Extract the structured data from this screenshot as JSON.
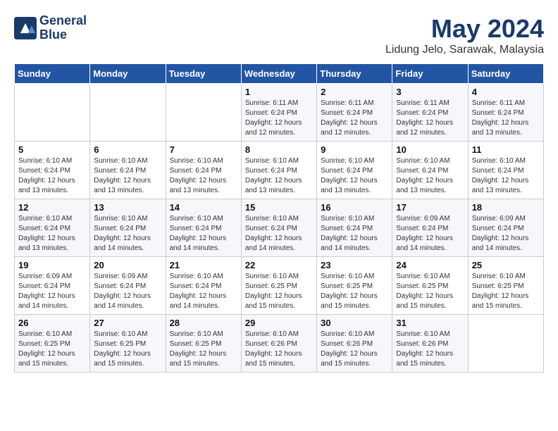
{
  "header": {
    "logo_line1": "General",
    "logo_line2": "Blue",
    "month": "May 2024",
    "location": "Lidung Jelo, Sarawak, Malaysia"
  },
  "days_of_week": [
    "Sunday",
    "Monday",
    "Tuesday",
    "Wednesday",
    "Thursday",
    "Friday",
    "Saturday"
  ],
  "weeks": [
    [
      {
        "day": "",
        "info": ""
      },
      {
        "day": "",
        "info": ""
      },
      {
        "day": "",
        "info": ""
      },
      {
        "day": "1",
        "info": "Sunrise: 6:11 AM\nSunset: 6:24 PM\nDaylight: 12 hours\nand 12 minutes."
      },
      {
        "day": "2",
        "info": "Sunrise: 6:11 AM\nSunset: 6:24 PM\nDaylight: 12 hours\nand 12 minutes."
      },
      {
        "day": "3",
        "info": "Sunrise: 6:11 AM\nSunset: 6:24 PM\nDaylight: 12 hours\nand 12 minutes."
      },
      {
        "day": "4",
        "info": "Sunrise: 6:11 AM\nSunset: 6:24 PM\nDaylight: 12 hours\nand 13 minutes."
      }
    ],
    [
      {
        "day": "5",
        "info": "Sunrise: 6:10 AM\nSunset: 6:24 PM\nDaylight: 12 hours\nand 13 minutes."
      },
      {
        "day": "6",
        "info": "Sunrise: 6:10 AM\nSunset: 6:24 PM\nDaylight: 12 hours\nand 13 minutes."
      },
      {
        "day": "7",
        "info": "Sunrise: 6:10 AM\nSunset: 6:24 PM\nDaylight: 12 hours\nand 13 minutes."
      },
      {
        "day": "8",
        "info": "Sunrise: 6:10 AM\nSunset: 6:24 PM\nDaylight: 12 hours\nand 13 minutes."
      },
      {
        "day": "9",
        "info": "Sunrise: 6:10 AM\nSunset: 6:24 PM\nDaylight: 12 hours\nand 13 minutes."
      },
      {
        "day": "10",
        "info": "Sunrise: 6:10 AM\nSunset: 6:24 PM\nDaylight: 12 hours\nand 13 minutes."
      },
      {
        "day": "11",
        "info": "Sunrise: 6:10 AM\nSunset: 6:24 PM\nDaylight: 12 hours\nand 13 minutes."
      }
    ],
    [
      {
        "day": "12",
        "info": "Sunrise: 6:10 AM\nSunset: 6:24 PM\nDaylight: 12 hours\nand 13 minutes."
      },
      {
        "day": "13",
        "info": "Sunrise: 6:10 AM\nSunset: 6:24 PM\nDaylight: 12 hours\nand 14 minutes."
      },
      {
        "day": "14",
        "info": "Sunrise: 6:10 AM\nSunset: 6:24 PM\nDaylight: 12 hours\nand 14 minutes."
      },
      {
        "day": "15",
        "info": "Sunrise: 6:10 AM\nSunset: 6:24 PM\nDaylight: 12 hours\nand 14 minutes."
      },
      {
        "day": "16",
        "info": "Sunrise: 6:10 AM\nSunset: 6:24 PM\nDaylight: 12 hours\nand 14 minutes."
      },
      {
        "day": "17",
        "info": "Sunrise: 6:09 AM\nSunset: 6:24 PM\nDaylight: 12 hours\nand 14 minutes."
      },
      {
        "day": "18",
        "info": "Sunrise: 6:09 AM\nSunset: 6:24 PM\nDaylight: 12 hours\nand 14 minutes."
      }
    ],
    [
      {
        "day": "19",
        "info": "Sunrise: 6:09 AM\nSunset: 6:24 PM\nDaylight: 12 hours\nand 14 minutes."
      },
      {
        "day": "20",
        "info": "Sunrise: 6:09 AM\nSunset: 6:24 PM\nDaylight: 12 hours\nand 14 minutes."
      },
      {
        "day": "21",
        "info": "Sunrise: 6:10 AM\nSunset: 6:24 PM\nDaylight: 12 hours\nand 14 minutes."
      },
      {
        "day": "22",
        "info": "Sunrise: 6:10 AM\nSunset: 6:25 PM\nDaylight: 12 hours\nand 15 minutes."
      },
      {
        "day": "23",
        "info": "Sunrise: 6:10 AM\nSunset: 6:25 PM\nDaylight: 12 hours\nand 15 minutes."
      },
      {
        "day": "24",
        "info": "Sunrise: 6:10 AM\nSunset: 6:25 PM\nDaylight: 12 hours\nand 15 minutes."
      },
      {
        "day": "25",
        "info": "Sunrise: 6:10 AM\nSunset: 6:25 PM\nDaylight: 12 hours\nand 15 minutes."
      }
    ],
    [
      {
        "day": "26",
        "info": "Sunrise: 6:10 AM\nSunset: 6:25 PM\nDaylight: 12 hours\nand 15 minutes."
      },
      {
        "day": "27",
        "info": "Sunrise: 6:10 AM\nSunset: 6:25 PM\nDaylight: 12 hours\nand 15 minutes."
      },
      {
        "day": "28",
        "info": "Sunrise: 6:10 AM\nSunset: 6:25 PM\nDaylight: 12 hours\nand 15 minutes."
      },
      {
        "day": "29",
        "info": "Sunrise: 6:10 AM\nSunset: 6:26 PM\nDaylight: 12 hours\nand 15 minutes."
      },
      {
        "day": "30",
        "info": "Sunrise: 6:10 AM\nSunset: 6:26 PM\nDaylight: 12 hours\nand 15 minutes."
      },
      {
        "day": "31",
        "info": "Sunrise: 6:10 AM\nSunset: 6:26 PM\nDaylight: 12 hours\nand 15 minutes."
      },
      {
        "day": "",
        "info": ""
      }
    ]
  ]
}
